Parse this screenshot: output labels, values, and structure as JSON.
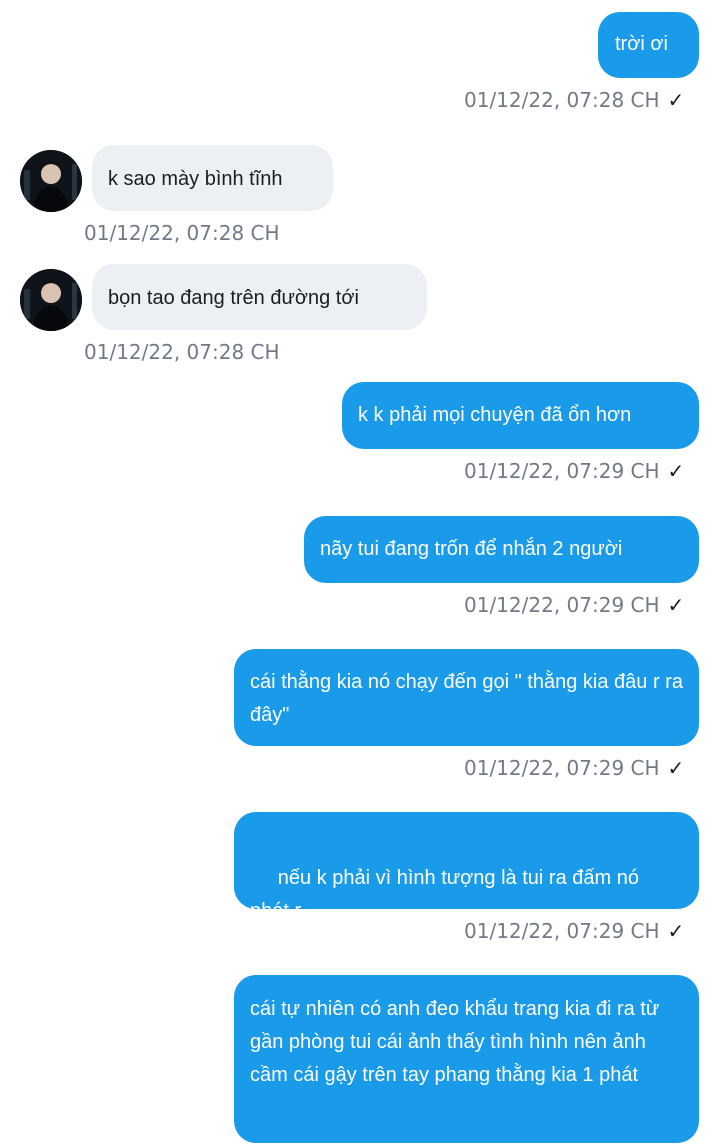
{
  "messages": [
    {
      "id": "m1",
      "direction": "out",
      "text": "trời ơi",
      "time": "01/12/22,  07:28 CH",
      "status_icon": "check-icon"
    },
    {
      "id": "m2",
      "direction": "in",
      "text": "k sao mày bình tĩnh",
      "time": "01/12/22,  07:28 CH",
      "avatar_icon": "contact-avatar"
    },
    {
      "id": "m3",
      "direction": "in",
      "text": "bọn tao đang trên đường tới",
      "time": "01/12/22,  07:28 CH",
      "avatar_icon": "contact-avatar"
    },
    {
      "id": "m4",
      "direction": "out",
      "text": "k k phải mọi chuyện đã ổn hơn",
      "time": "01/12/22,  07:29 CH",
      "status_icon": "check-icon"
    },
    {
      "id": "m5",
      "direction": "out",
      "text": "nãy tui đang trốn để nhắn 2 người",
      "time": "01/12/22,  07:29 CH",
      "status_icon": "check-icon"
    },
    {
      "id": "m6",
      "direction": "out",
      "text": "cái thằng kia nó chạy đến gọi \" thằng kia đâu r ra đây\"",
      "time": "01/12/22,  07:29 CH",
      "status_icon": "check-icon"
    },
    {
      "id": "m7",
      "direction": "out",
      "text": " nếu k phải vì hình tượng là tui ra đấm nó phát r",
      "time": "01/12/22,  07:29 CH",
      "status_icon": "check-icon"
    },
    {
      "id": "m8",
      "direction": "out",
      "text": "cái tự nhiên có anh đeo khẩu trang kia đi ra từ gần phòng tui cái ảnh thấy tình hình nên ảnh cầm cái gậy trên tay phang thằng kia 1 phát",
      "time": "",
      "status_icon": ""
    }
  ],
  "colors": {
    "outgoing_bubble": "#1a9be9",
    "incoming_bubble": "#eceff3",
    "timestamp": "#717a86"
  },
  "icons": {
    "check": "✓"
  }
}
